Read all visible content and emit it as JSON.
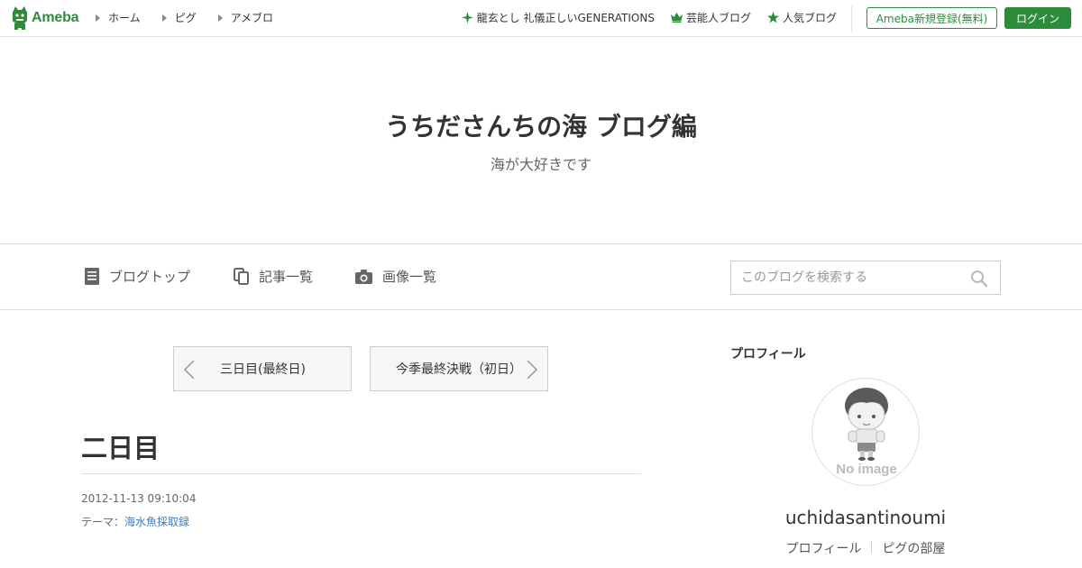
{
  "header": {
    "logo_text": "Ameba",
    "nav_left": [
      {
        "label": "ホーム"
      },
      {
        "label": "ピグ"
      },
      {
        "label": "アメブロ"
      }
    ],
    "nav_right": [
      {
        "label": "龍玄とし 礼儀正しいGENERATIONS",
        "icon": "sparkle-icon"
      },
      {
        "label": "芸能人ブログ",
        "icon": "crown-icon"
      },
      {
        "label": "人気ブログ",
        "icon": "star-icon"
      }
    ],
    "register_label": "Ameba新規登録(無料)",
    "login_label": "ログイン",
    "accent_color": "#2d8c3c"
  },
  "blog": {
    "title": "うちださんちの海 ブログ編",
    "description": "海が大好きです"
  },
  "blog_nav": {
    "items": [
      {
        "label": "ブログトップ",
        "icon": "document-icon"
      },
      {
        "label": "記事一覧",
        "icon": "copy-icon"
      },
      {
        "label": "画像一覧",
        "icon": "camera-icon"
      }
    ],
    "search_placeholder": "このブログを検索する"
  },
  "article": {
    "prev_label": "三日目(最終日)",
    "next_label": "今季最終決戦（初日）",
    "title": "二日目",
    "date": "2012-11-13 09:10:04",
    "theme_prefix": "テーマ：",
    "theme": "海水魚採取録"
  },
  "profile": {
    "heading": "プロフィール",
    "avatar_caption": "No image",
    "name": "uchidasantinoumi",
    "links": [
      {
        "label": "プロフィール"
      },
      {
        "label": "ピグの部屋"
      }
    ]
  }
}
